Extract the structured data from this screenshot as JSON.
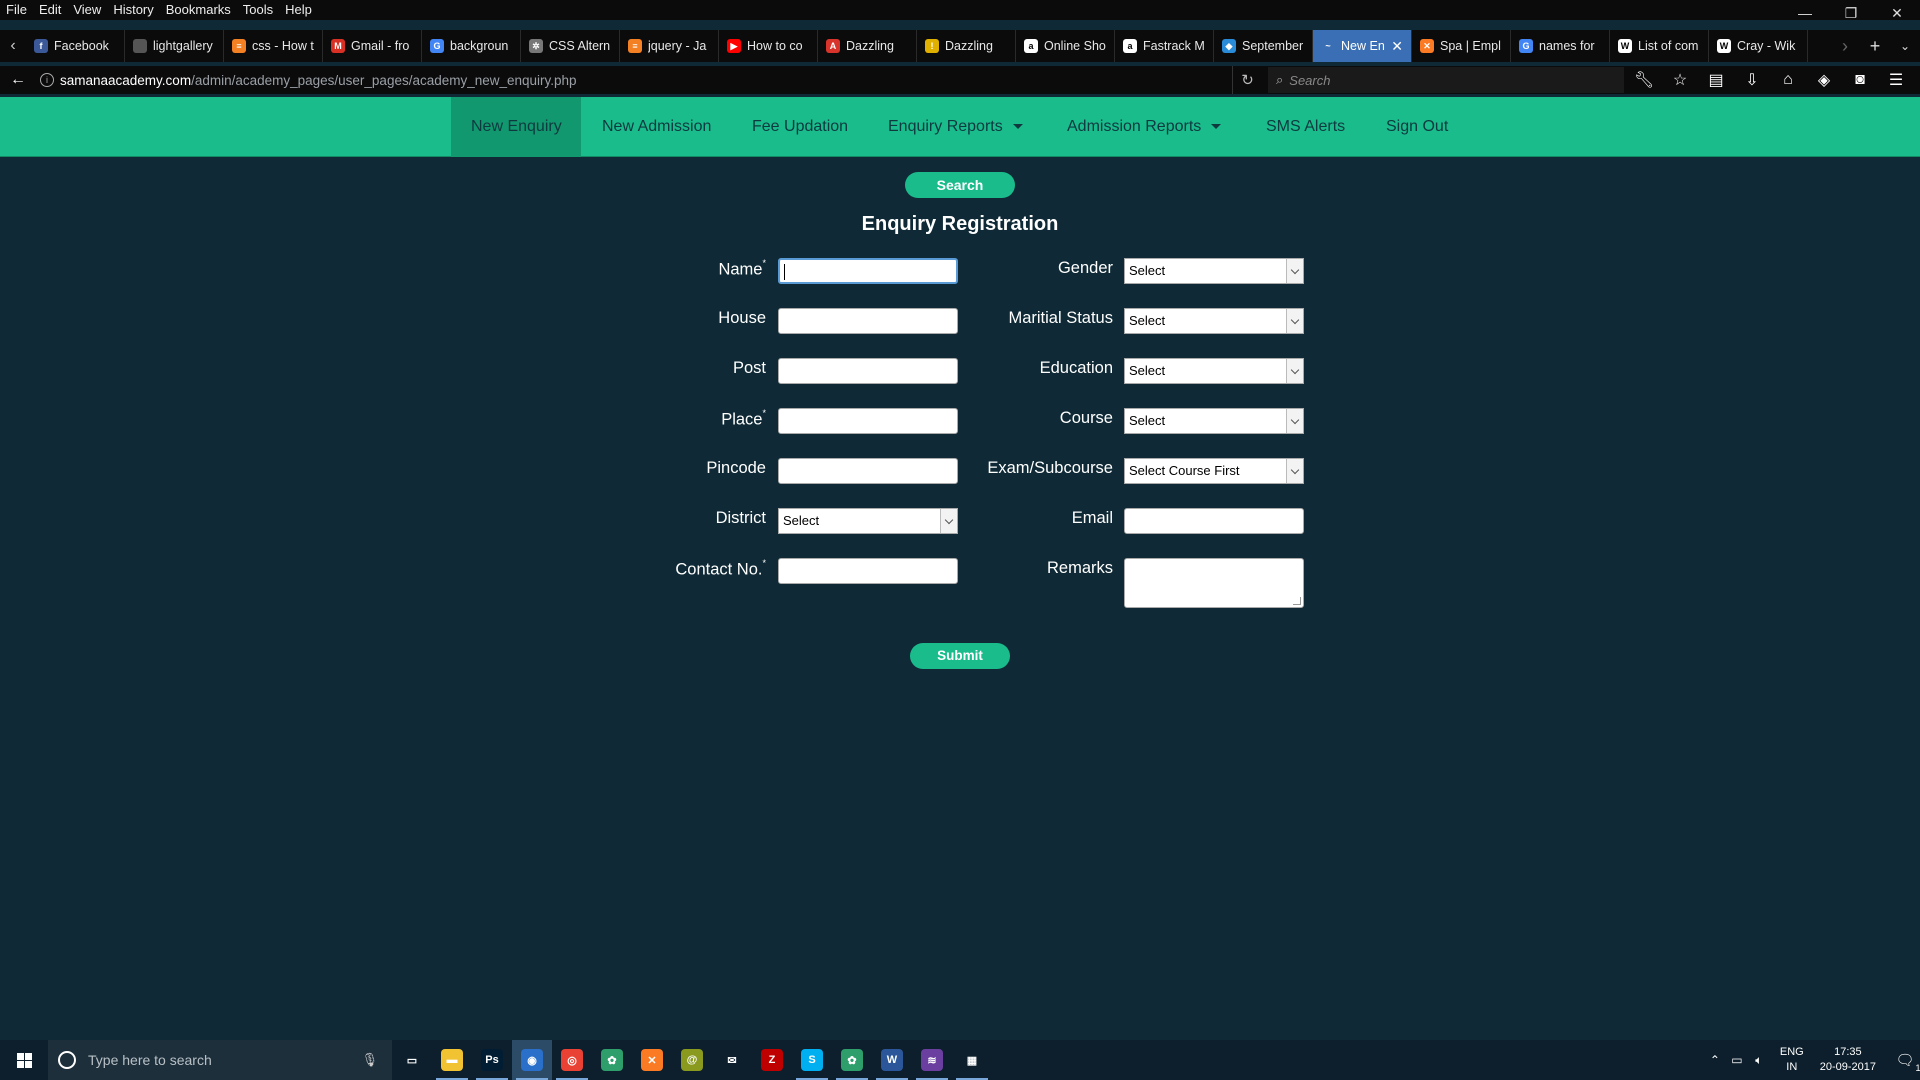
{
  "browser": {
    "menu": [
      "File",
      "Edit",
      "View",
      "History",
      "Bookmarks",
      "Tools",
      "Help"
    ],
    "tabs": [
      {
        "title": "Facebook",
        "icon": "facebook-icon",
        "color": "#3b5998",
        "glyph": "f"
      },
      {
        "title": "lightgallery",
        "icon": "page-icon",
        "color": "#555555",
        "glyph": ""
      },
      {
        "title": "css - How t",
        "icon": "stackoverflow-icon",
        "color": "#f48024",
        "glyph": "≡"
      },
      {
        "title": "Gmail - fro",
        "icon": "gmail-icon",
        "color": "#d93025",
        "glyph": "M"
      },
      {
        "title": "backgroun",
        "icon": "google-icon",
        "color": "#4285f4",
        "glyph": "G"
      },
      {
        "title": "CSS Altern",
        "icon": "gear-icon",
        "color": "#777777",
        "glyph": "✲"
      },
      {
        "title": "jquery - Ja",
        "icon": "stackoverflow-icon",
        "color": "#f48024",
        "glyph": "≡"
      },
      {
        "title": "How to co",
        "icon": "youtube-icon",
        "color": "#ff0000",
        "glyph": "▶"
      },
      {
        "title": "Dazzling",
        "icon": "pdf-icon",
        "color": "#d9342b",
        "glyph": "A"
      },
      {
        "title": "Dazzling",
        "icon": "warning-icon",
        "color": "#e0b000",
        "glyph": "!"
      },
      {
        "title": "Online Sho",
        "icon": "amazon-icon",
        "color": "#ffffff",
        "glyph": "a"
      },
      {
        "title": "Fastrack M",
        "icon": "amazon-icon",
        "color": "#ffffff",
        "glyph": "a"
      },
      {
        "title": "September",
        "icon": "vscode-icon",
        "color": "#2a8bd8",
        "glyph": "◆"
      },
      {
        "title": "New En",
        "icon": "feather-icon",
        "color": "#3a6fb5",
        "glyph": "~",
        "active": true
      },
      {
        "title": "Spa | Empl",
        "icon": "xampp-icon",
        "color": "#fb7a24",
        "glyph": "✕"
      },
      {
        "title": "names for",
        "icon": "google-icon",
        "color": "#4285f4",
        "glyph": "G"
      },
      {
        "title": "List of com",
        "icon": "wikipedia-icon",
        "color": "#ffffff",
        "glyph": "W"
      },
      {
        "title": "Cray - Wik",
        "icon": "wikipedia-icon",
        "color": "#ffffff",
        "glyph": "W"
      }
    ],
    "url_host": "samanaacademy.com",
    "url_path": "/admin/academy_pages/user_pages/academy_new_enquiry.php",
    "search_placeholder": "Search"
  },
  "site_nav": {
    "items": [
      {
        "label": "New Enquiry",
        "active": true
      },
      {
        "label": "New Admission"
      },
      {
        "label": "Fee Updation"
      },
      {
        "label": "Enquiry Reports",
        "dropdown": true
      },
      {
        "label": "Admission Reports",
        "dropdown": true
      },
      {
        "label": "SMS Alerts"
      },
      {
        "label": "Sign Out"
      }
    ]
  },
  "page": {
    "search_button": "Search",
    "form_title": "Enquiry Registration",
    "required_mark": "*",
    "left_fields": {
      "name": "Name",
      "house": "House",
      "post": "Post",
      "place": "Place",
      "pincode": "Pincode",
      "district": "District",
      "district_value": "Select",
      "contact": "Contact No."
    },
    "right_fields": {
      "gender": "Gender",
      "gender_value": "Select",
      "marital": "Maritial Status",
      "marital_value": "Select",
      "education": "Education",
      "education_value": "Select",
      "course": "Course",
      "course_value": "Select",
      "exam": "Exam/Subcourse",
      "exam_value": "Select Course First",
      "email": "Email",
      "remarks": "Remarks"
    },
    "submit_button": "Submit"
  },
  "taskbar": {
    "search_placeholder": "Type here to search",
    "apps": [
      {
        "name": "task-view-icon",
        "color": "#0d1f2c",
        "glyph": "▭"
      },
      {
        "name": "file-explorer-icon",
        "color": "#f1c232",
        "glyph": "▬",
        "running": true
      },
      {
        "name": "photoshop-icon",
        "color": "#001d34",
        "glyph": "Ps",
        "running": true
      },
      {
        "name": "firefox-icon",
        "color": "#2a6fc9",
        "glyph": "◉",
        "running": true,
        "active": true
      },
      {
        "name": "chrome-icon",
        "color": "#e94235",
        "glyph": "◎",
        "running": true
      },
      {
        "name": "app-green-icon",
        "color": "#2e9e6b",
        "glyph": "✿"
      },
      {
        "name": "xampp-icon",
        "color": "#fb7a24",
        "glyph": "✕"
      },
      {
        "name": "app-spiral-icon",
        "color": "#8a9a1f",
        "glyph": "@"
      },
      {
        "name": "mail-icon",
        "color": "#0d1f2c",
        "glyph": "✉"
      },
      {
        "name": "filezilla-icon",
        "color": "#bf0000",
        "glyph": "Z"
      },
      {
        "name": "skype-icon",
        "color": "#00aff0",
        "glyph": "S",
        "running": true
      },
      {
        "name": "app-green2-icon",
        "color": "#2e9e6b",
        "glyph": "✿",
        "running": true
      },
      {
        "name": "word-icon",
        "color": "#2b579a",
        "glyph": "W",
        "running": true
      },
      {
        "name": "app-flag-icon",
        "color": "#6a3fa0",
        "glyph": "≋",
        "running": true
      },
      {
        "name": "calculator-icon",
        "color": "#0d1f2c",
        "glyph": "▦",
        "running": true
      }
    ],
    "lang_top": "ENG",
    "lang_bottom": "IN",
    "time": "17:35",
    "date": "20-09-2017",
    "notification_count": "1"
  }
}
